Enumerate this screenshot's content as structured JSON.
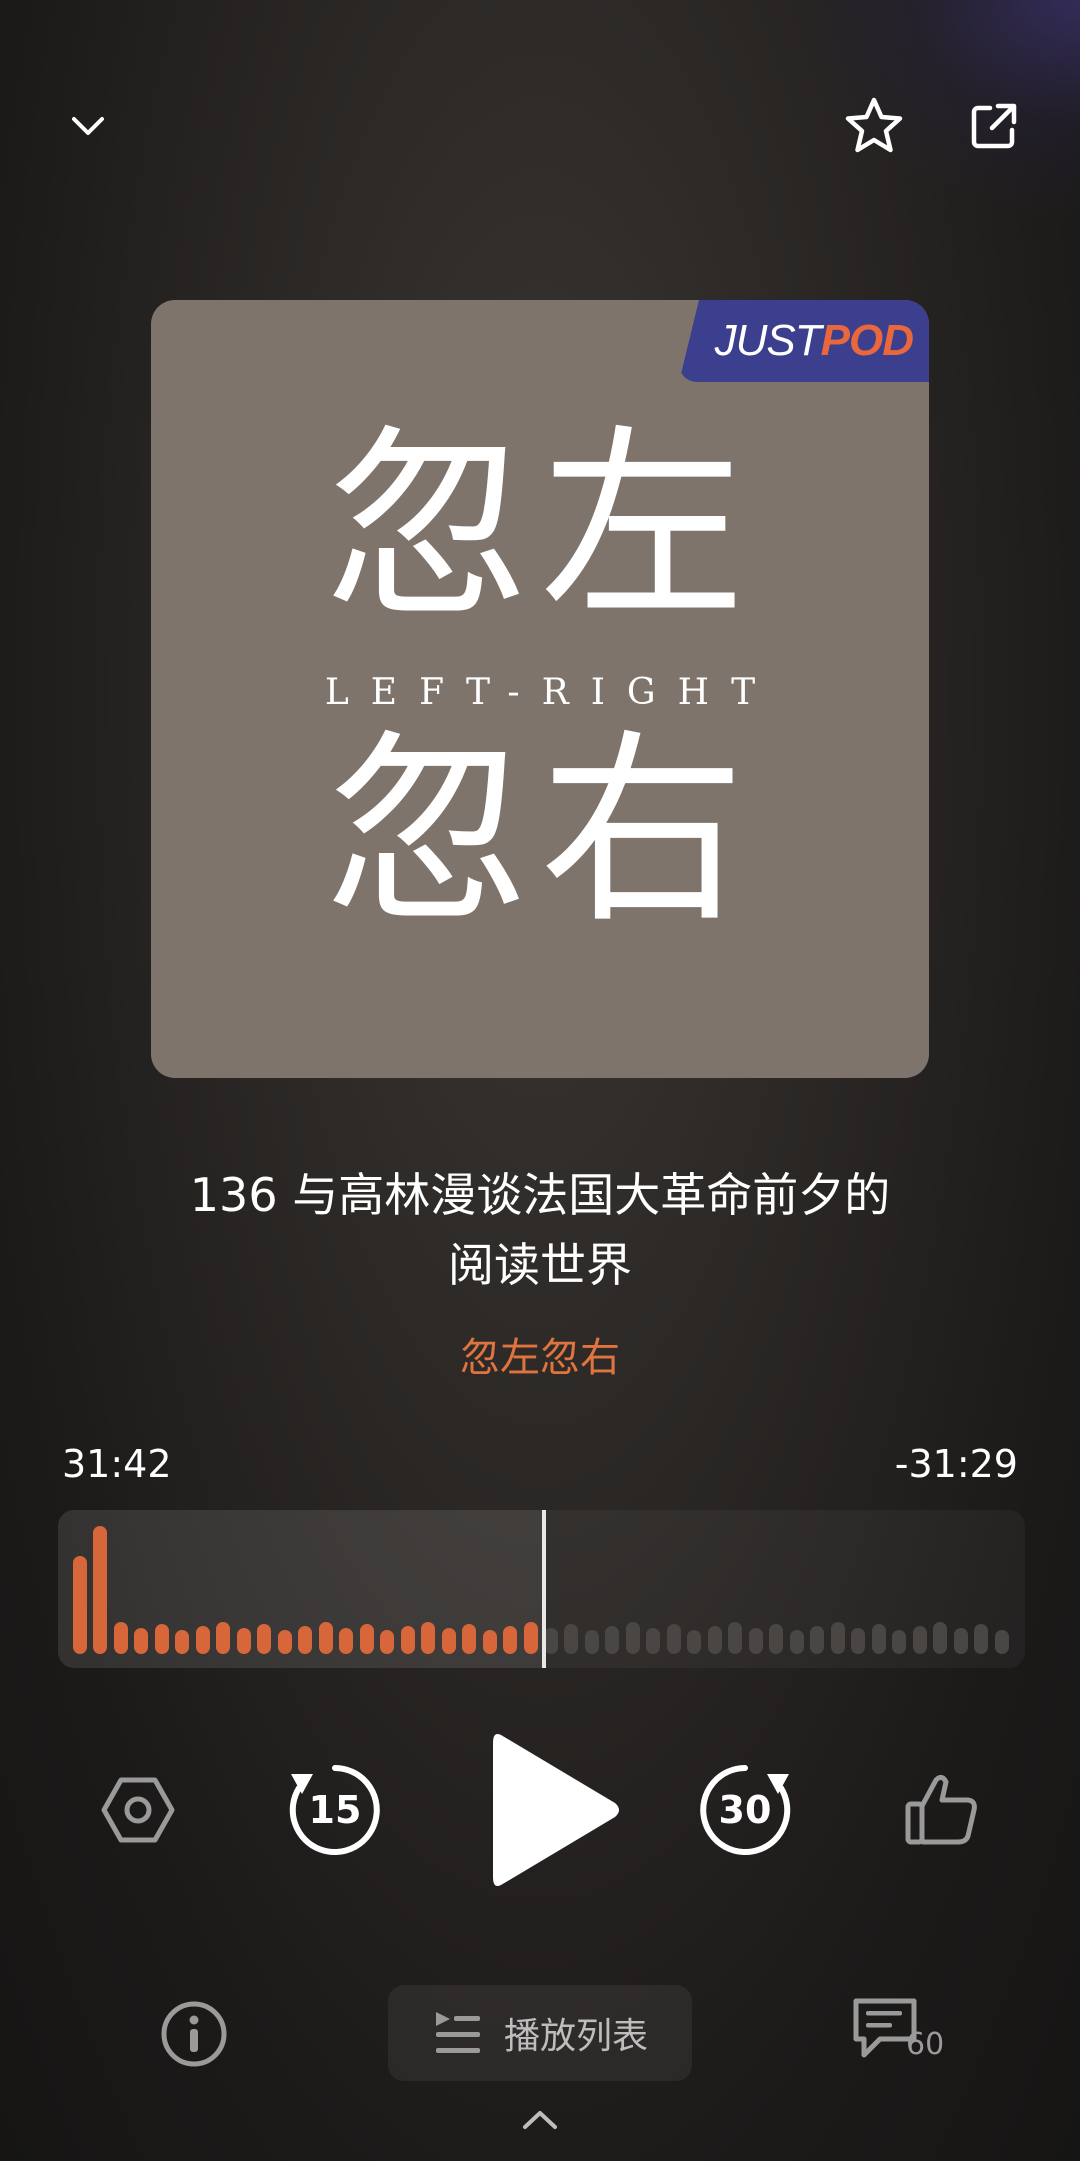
{
  "header": {
    "collapse_icon": "chevron-down-icon",
    "favorite_icon": "star-outline-icon",
    "share_icon": "external-link-icon"
  },
  "cover": {
    "badge_just": "JUST",
    "badge_pod": "POD",
    "title_top": "忽左",
    "subtitle": "LEFT-RIGHT",
    "title_bottom": "忽右",
    "bg_color": "#7e746c",
    "badge_color": "#3c3e8e",
    "badge_accent": "#e8673c"
  },
  "episode": {
    "title_line1": "136 与高林漫谈法国大革命前夕的",
    "title_line2": "阅读世界",
    "podcast_name": "忽左忽右",
    "accent_color": "#e0743e"
  },
  "progress": {
    "elapsed": "31:42",
    "remaining": "-31:29",
    "fraction": 0.5,
    "played_color": "#d7673a",
    "unplayed_color": "#4a4644"
  },
  "controls": {
    "settings_icon": "hexagon-settings-icon",
    "rewind_seconds": "15",
    "play_icon": "play-icon",
    "forward_seconds": "30",
    "like_icon": "thumbs-up-icon"
  },
  "bottom": {
    "info_icon": "info-icon",
    "playlist_label": "播放列表",
    "playlist_icon": "playlist-icon",
    "comment_icon": "comment-icon",
    "comment_count": "60",
    "expand_icon": "chevron-up-icon"
  }
}
